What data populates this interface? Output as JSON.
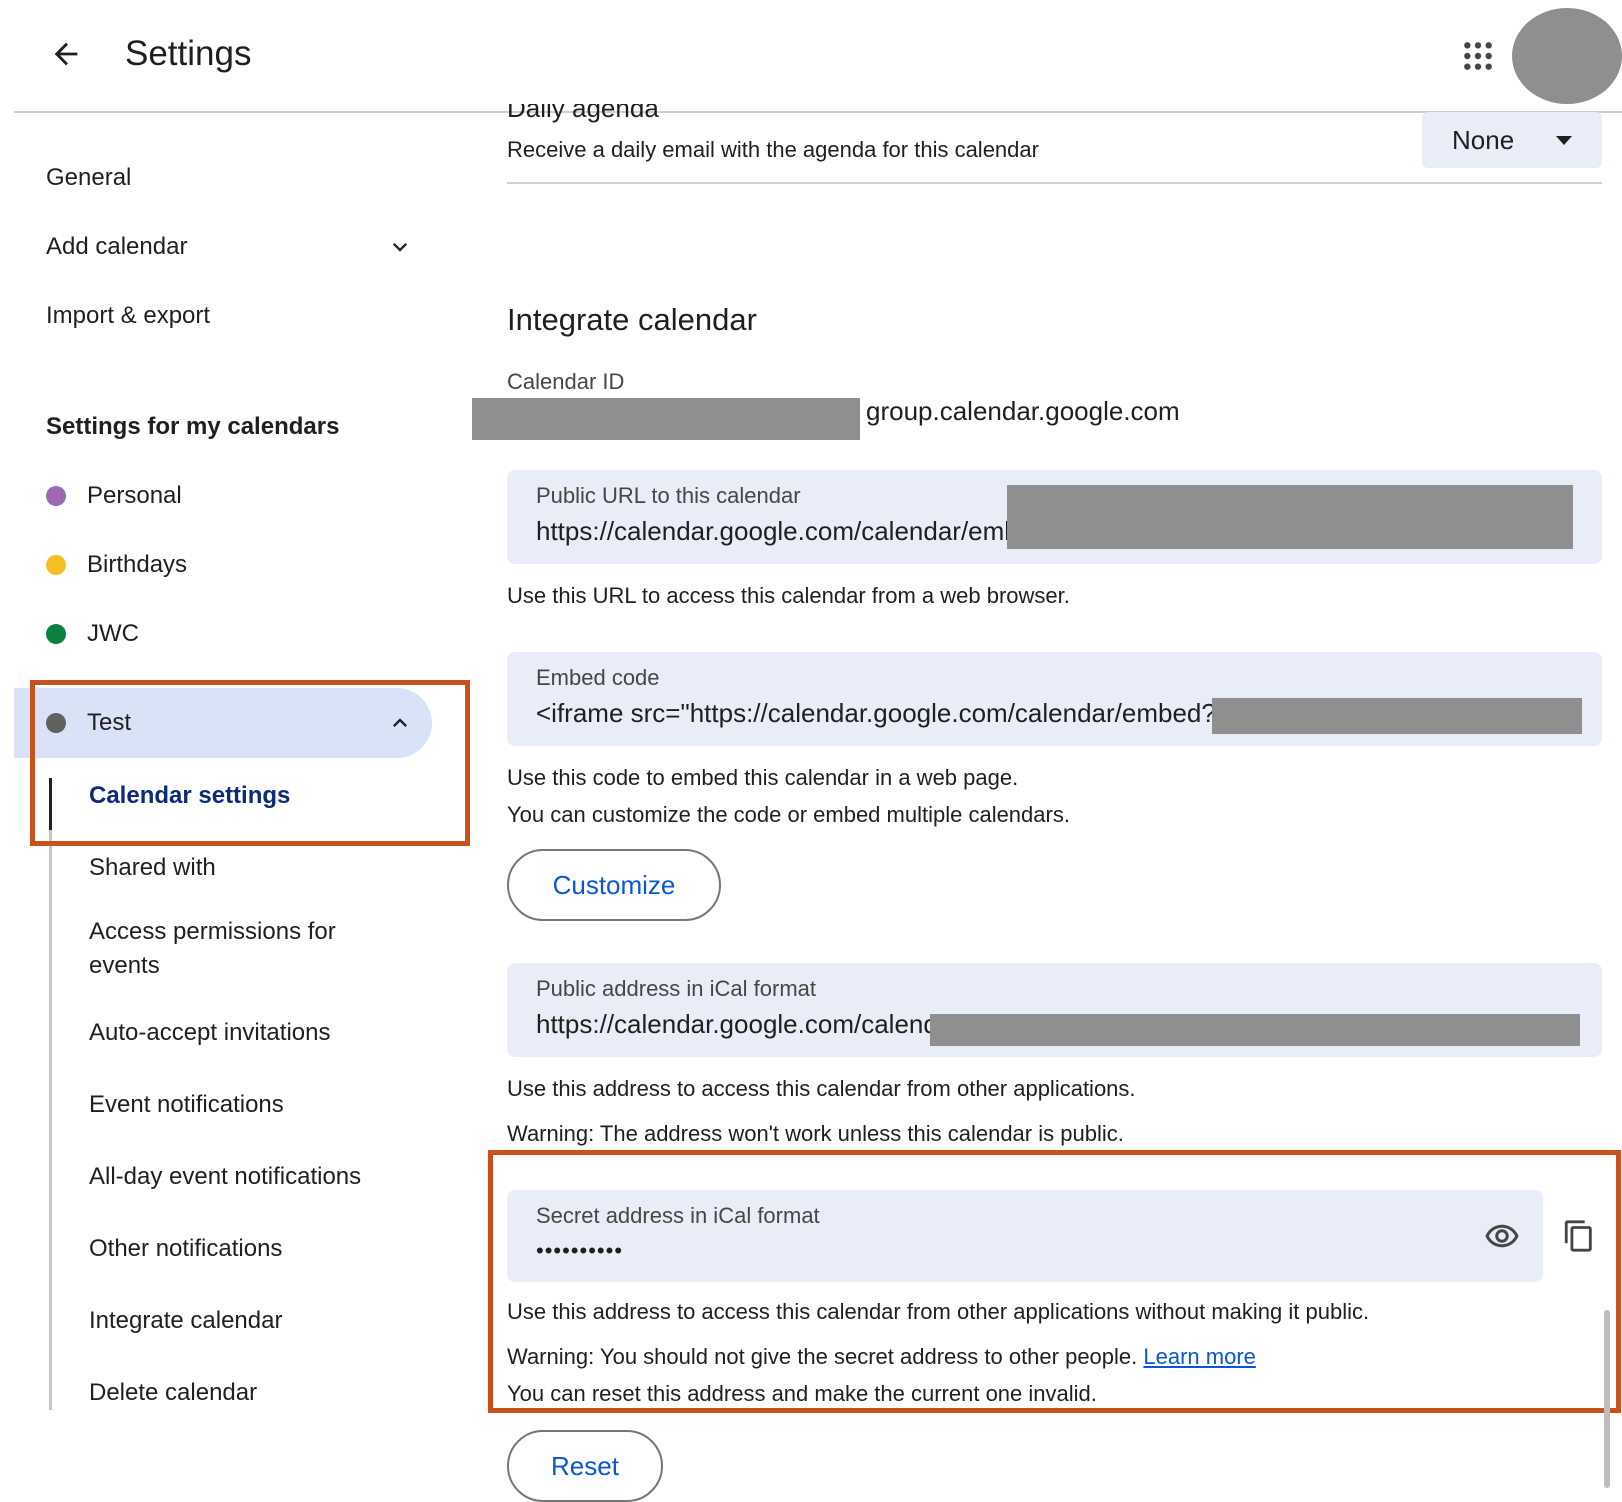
{
  "header": {
    "title": "Settings",
    "back_icon": "arrow-back-icon",
    "apps_icon": "apps-grid-icon"
  },
  "sidebar": {
    "top_items": [
      {
        "label": "General"
      },
      {
        "label": "Add calendar"
      },
      {
        "label": "Import & export"
      }
    ],
    "my_calendars_title": "Settings for my calendars",
    "calendars": [
      {
        "label": "Personal",
        "color": "#9e69af"
      },
      {
        "label": "Birthdays",
        "color": "#f6bf26"
      },
      {
        "label": "JWC",
        "color": "#0b8043"
      },
      {
        "label": "Test",
        "color": "#616161"
      }
    ],
    "sub_items": [
      {
        "label": "Calendar settings"
      },
      {
        "label": "Shared with"
      },
      {
        "label": "Access permissions for events"
      },
      {
        "label": "Auto-accept invitations"
      },
      {
        "label": "Event notifications"
      },
      {
        "label": "All-day event notifications"
      },
      {
        "label": "Other notifications"
      },
      {
        "label": "Integrate calendar"
      },
      {
        "label": "Delete calendar"
      }
    ]
  },
  "daily_agenda": {
    "title": "Daily agenda",
    "description": "Receive a daily email with the agenda for this calendar",
    "selected": "None"
  },
  "integrate": {
    "section_title": "Integrate calendar",
    "calendar_id_label": "Calendar ID",
    "calendar_id_value": "group.calendar.google.com",
    "public_url": {
      "label": "Public URL to this calendar",
      "value": "https://calendar.google.com/calendar/emb",
      "help": "Use this URL to access this calendar from a web browser."
    },
    "embed": {
      "label": "Embed code",
      "value": "<iframe src=\"https://calendar.google.com/calendar/embed?",
      "help1": "Use this code to embed this calendar in a web page.",
      "help2": "You can customize the code or embed multiple calendars.",
      "button": "Customize"
    },
    "public_ical": {
      "label": "Public address in iCal format",
      "value": "https://calendar.google.com/calend",
      "help1": "Use this address to access this calendar from other applications.",
      "help2": "Warning: The address won't work unless this calendar is public."
    },
    "secret_ical": {
      "label": "Secret address in iCal format",
      "value": "••••••••••",
      "help1": "Use this address to access this calendar from other applications without making it public.",
      "help2": "Warning: You should not give the secret address to other people.",
      "learn_more": "Learn more",
      "help3": "You can reset this address and make the current one invalid.",
      "button": "Reset"
    }
  },
  "colors": {
    "accent": "#0b57d0",
    "highlight": "#c8511e",
    "selected_bg": "#d8e3f8",
    "field_bg": "#e8edf7"
  }
}
